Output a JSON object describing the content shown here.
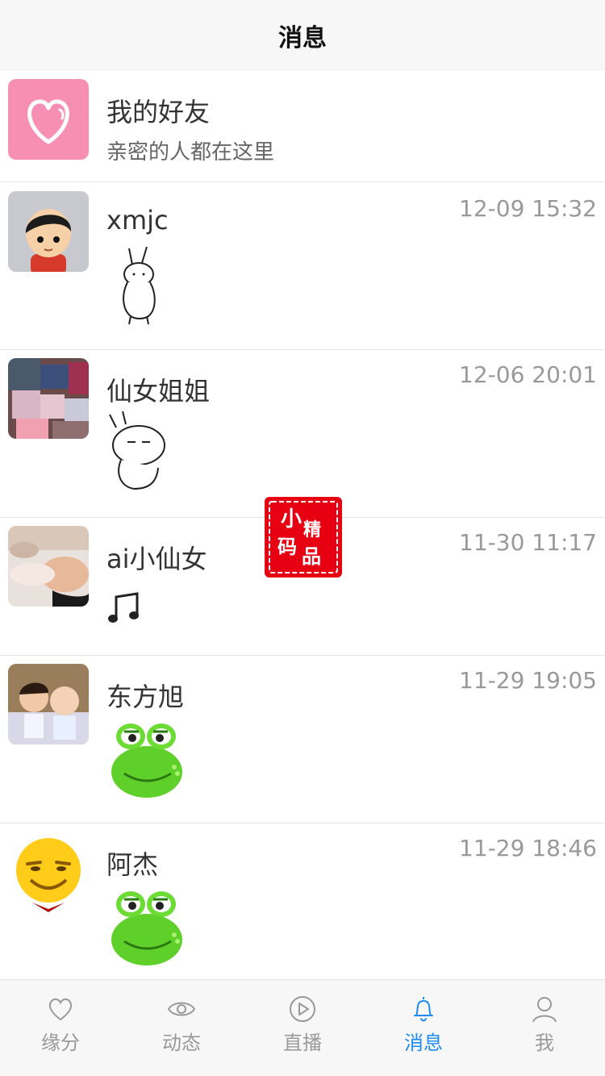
{
  "header": {
    "title": "消息"
  },
  "friends": {
    "title": "我的好友",
    "subtitle": "亲密的人都在这里",
    "icon": "heart-icon"
  },
  "messages": [
    {
      "name": "xmjc",
      "time": "12-09 15:32",
      "preview": "rabbit-sticker"
    },
    {
      "name": "仙女姐姐",
      "time": "12-06 20:01",
      "preview": "rabbit-sticker"
    },
    {
      "name": "ai小仙女",
      "time": "11-30 11:17",
      "preview": "music-note-icon"
    },
    {
      "name": "东方旭",
      "time": "11-29 19:05",
      "preview": "frog-sticker"
    },
    {
      "name": "阿杰",
      "time": "11-29 18:46",
      "preview": "frog-sticker"
    }
  ],
  "watermark": {
    "text": "小码精品"
  },
  "tabs": [
    {
      "label": "缘分",
      "icon": "heart-outline-icon",
      "active": false
    },
    {
      "label": "动态",
      "icon": "eye-icon",
      "active": false
    },
    {
      "label": "直播",
      "icon": "play-circle-icon",
      "active": false
    },
    {
      "label": "消息",
      "icon": "bell-icon",
      "active": true
    },
    {
      "label": "我",
      "icon": "user-icon",
      "active": false
    }
  ],
  "colors": {
    "accent": "#1e8bf0",
    "friends_bg": "#f78fb3",
    "seal_red": "#e60012"
  }
}
